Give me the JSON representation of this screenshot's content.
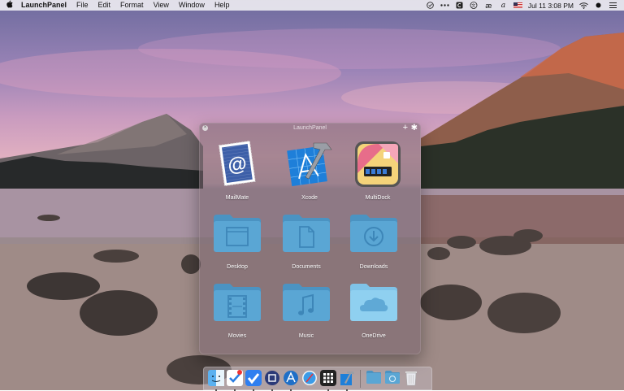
{
  "menubar": {
    "app_name": "LaunchPanel",
    "menus": [
      "File",
      "Edit",
      "Format",
      "View",
      "Window",
      "Help"
    ],
    "clock": "Jul 11  3:08 PM",
    "status_icons": [
      "checkmark-circle-icon",
      "more-dots-icon",
      "c-app-icon",
      "translate-icon",
      "ae-icon",
      "script-a-icon",
      "us-flag-icon",
      "wifi-icon",
      "record-dot-icon"
    ]
  },
  "panel": {
    "title": "LaunchPanel",
    "items": [
      {
        "label": "MailMate",
        "icon": "mailmate-icon"
      },
      {
        "label": "Xcode",
        "icon": "xcode-icon"
      },
      {
        "label": "MultiDock",
        "icon": "multidock-icon"
      },
      {
        "label": "Desktop",
        "icon": "desktop-folder-icon"
      },
      {
        "label": "Documents",
        "icon": "documents-folder-icon"
      },
      {
        "label": "Downloads",
        "icon": "downloads-folder-icon"
      },
      {
        "label": "Movies",
        "icon": "movies-folder-icon"
      },
      {
        "label": "Music",
        "icon": "music-folder-icon"
      },
      {
        "label": "OneDrive",
        "icon": "onedrive-folder-icon"
      }
    ]
  },
  "dock": {
    "items": [
      "finder-icon",
      "tasks-icon",
      "checkmark-app-icon",
      "launchpanel-icon",
      "xcode-icon",
      "safari-icon",
      "grid-app-icon",
      "xcode-hammer-icon",
      "folder-icon",
      "downloads-stack-icon",
      "trash-icon"
    ]
  },
  "colors": {
    "folder_blue": "#5aa6d4",
    "folder_light": "#8fd0f0",
    "panel_bg": "#786e78"
  }
}
